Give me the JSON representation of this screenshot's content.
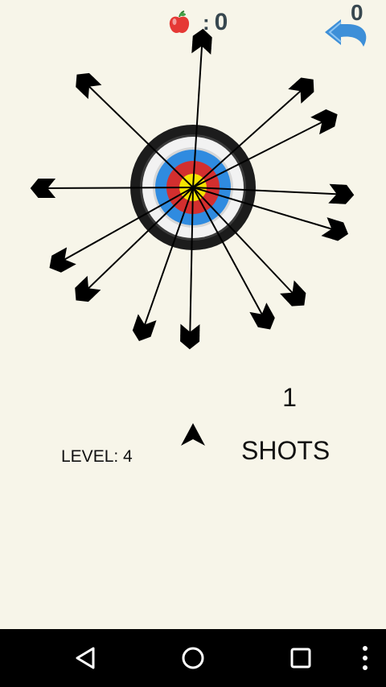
{
  "hud": {
    "apple_icon": "apple-icon",
    "separator": ":",
    "score": "0",
    "undo_count": "0",
    "undo_icon": "undo-icon"
  },
  "game": {
    "shots_remaining": "1",
    "shots_label": "SHOTS",
    "level_label": "LEVEL: 4"
  },
  "colors": {
    "background": "#f7f5e9",
    "hud_text": "#37474f",
    "undo_blue": "#3d8fd8",
    "target_outer": "#1c1c1c",
    "target_white": "#f2f2f2",
    "target_blue": "#2f8be0",
    "target_red": "#d32f2f",
    "target_yellow": "#f5e400"
  },
  "navbar": {
    "back_icon": "back-triangle-icon",
    "home_icon": "home-circle-icon",
    "recents_icon": "recents-square-icon",
    "menu_icon": "overflow-menu-icon"
  }
}
